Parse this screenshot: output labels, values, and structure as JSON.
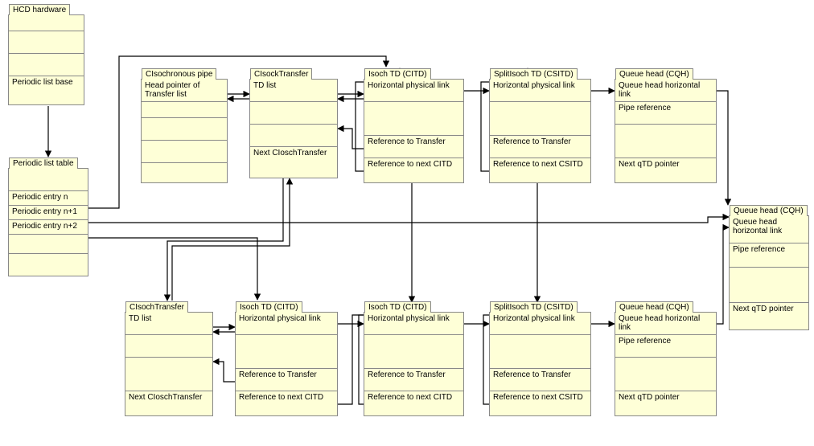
{
  "hcd": {
    "title": "HCD hardware",
    "rows": [
      "",
      "",
      "",
      "Periodic list base"
    ]
  },
  "plt": {
    "title": "Periodic list table",
    "rows": [
      "",
      "Periodic entry n",
      "Periodic entry n+1",
      "Periodic entry n+2",
      "",
      ""
    ]
  },
  "iso_pipe": {
    "title": "CIsochronous pipe",
    "rows": [
      "Head pointer of Transfer list",
      "",
      "",
      "",
      ""
    ]
  },
  "xfer_top": {
    "title": "CIsockTransfer",
    "rows": [
      "TD list",
      "",
      "",
      "Next CIoschTransfer"
    ]
  },
  "xfer_bot": {
    "title": "CIsochTransfer",
    "rows": [
      "TD list",
      "",
      "",
      "Next CIoschTransfer"
    ]
  },
  "itd1": {
    "title": "Isoch TD (CITD)",
    "rows": [
      "Horizontal physical link",
      "",
      "Reference to Transfer",
      "Reference to next CITD"
    ]
  },
  "itd2": {
    "title": "Isoch TD (CITD)",
    "rows": [
      "Horizontal physical link",
      "",
      "Reference to Transfer",
      "Reference to next CITD"
    ]
  },
  "itd3": {
    "title": "Isoch TD (CITD)",
    "rows": [
      "Horizontal physical link",
      "",
      "Reference to Transfer",
      "Reference to next CITD"
    ]
  },
  "sitd1": {
    "title": "SplitIsoch TD (CSITD)",
    "rows": [
      "Horizontal physical link",
      "",
      "Reference to Transfer",
      "Reference to next CSITD"
    ]
  },
  "sitd2": {
    "title": "SplitIsoch TD (CSITD)",
    "rows": [
      "Horizontal physical link",
      "",
      "Reference to Transfer",
      "Reference to next CSITD"
    ]
  },
  "qh1": {
    "title": "Queue head (CQH)",
    "rows": [
      "Queue head horizontal link",
      "Pipe reference",
      "",
      "Next qTD pointer"
    ]
  },
  "qh2": {
    "title": "Queue head (CQH)",
    "rows": [
      "Queue head horizontal link",
      "Pipe reference",
      "",
      "Next qTD pointer"
    ]
  },
  "qh3": {
    "title": "Queue head (CQH)",
    "rows": [
      "Queue head horizontal link",
      "Pipe reference",
      "",
      "Next qTD pointer"
    ]
  }
}
